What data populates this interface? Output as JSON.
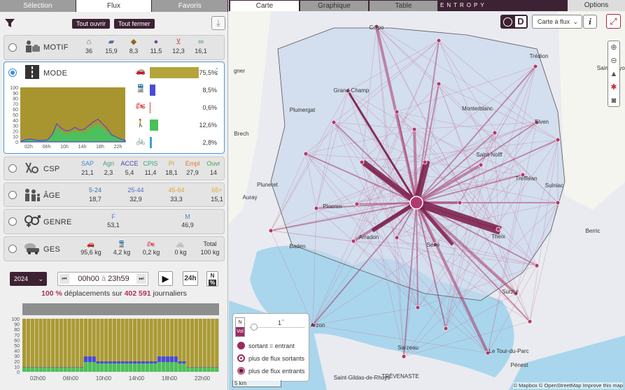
{
  "left_tabs": [
    "Sélection",
    "Flux",
    "Favoris"
  ],
  "toolbar": {
    "open_all": "Tout ouvrir",
    "close_all": "Tout fermer"
  },
  "motif": {
    "title": "MOTIF",
    "values": [
      "36",
      "15,9",
      "8,3",
      "11,5",
      "12,3",
      "16,1"
    ],
    "icons": [
      "home-icon",
      "briefcase-icon",
      "graduation-cap-icon",
      "ball-icon",
      "shopping-cart-icon",
      "glasses-icon"
    ],
    "colors": [
      "#4a7a3a",
      "#4b6ea7",
      "#8a6a1e",
      "#7a4aa0",
      "#c45a66",
      "#3d8a8a"
    ]
  },
  "mode": {
    "title": "MODE",
    "items": [
      {
        "icon": "car-icon",
        "label": "75,5%",
        "value": 75.5,
        "color": "#b5a43a"
      },
      {
        "icon": "train-icon",
        "label": "8,5%",
        "value": 8.5,
        "color": "#4a4ad8"
      },
      {
        "icon": "motorbike-icon",
        "label": "0,6%",
        "value": 0.6,
        "color": "#d44a4a"
      },
      {
        "icon": "walking-icon",
        "label": "12,6%",
        "value": 12.6,
        "color": "#4ac05a"
      },
      {
        "icon": "bicycle-icon",
        "label": "2,8%",
        "value": 2.8,
        "color": "#3aa0d0"
      }
    ],
    "chart_y": [
      "100",
      "90",
      "80",
      "70",
      "60",
      "50",
      "40",
      "30",
      "20",
      "10",
      "0"
    ],
    "chart_x": [
      "02h",
      "06h",
      "10h",
      "14h",
      "18h",
      "22h"
    ]
  },
  "csp": {
    "title": "CSP",
    "labels": [
      "SAP",
      "Agri",
      "ACCE",
      "CPIS",
      "PI",
      "Empl",
      "Ouvr"
    ],
    "values": [
      "21,1",
      "2,3",
      "5,4",
      "11,4",
      "18,1",
      "27,9",
      "14"
    ],
    "colors": [
      "#4a8ad8",
      "#4aa07a",
      "#3b4ab0",
      "#3aa07a",
      "#d8a030",
      "#e07a30",
      "#4aa050"
    ]
  },
  "age": {
    "title": "ÂGE",
    "labels": [
      "5-24",
      "25-44",
      "45-64",
      "65+"
    ],
    "values": [
      "18,7",
      "32,9",
      "33,3",
      "15,1"
    ],
    "colors": [
      "#3a70b0",
      "#4a70c8",
      "#e0a030",
      "#e8a830"
    ]
  },
  "genre": {
    "title": "GENRE",
    "labels": [
      "F",
      "M"
    ],
    "values": [
      "53,1",
      "46,9"
    ]
  },
  "ges": {
    "title": "GES",
    "values": [
      "95,6 kg",
      "4,2 kg",
      "0,2 kg",
      "0 kg",
      "100 kg"
    ],
    "total": "Total"
  },
  "time": {
    "year": "2024",
    "from": "00h00",
    "sep": "à",
    "to": "23h59",
    "range_btn": "24h",
    "n_btn": "N",
    "pct": "100 %",
    "mid": "déplacements sur",
    "count": "402 591",
    "end": "journaliers"
  },
  "bottom_chart": {
    "y": [
      "100",
      "90",
      "80",
      "70",
      "60",
      "50",
      "40",
      "30",
      "20",
      "10",
      "0"
    ],
    "x": [
      "02h00",
      "06h00",
      "10h00",
      "14h00",
      "18h00",
      "22h00"
    ]
  },
  "map_tabs": [
    "Carte",
    "Graphique",
    "Table"
  ],
  "brand": "ENTROPY",
  "options": "Options",
  "map_ctrl": {
    "d_letter": "D",
    "view_select": "Carte à flux",
    "info": "i"
  },
  "legend": {
    "n": "N",
    "vol": "Vol",
    "count": "1",
    "r1": "sortant = entrant",
    "r2": "plus de flux sortants",
    "r3": "plus de flux entrants",
    "c1": "#9b2b5f",
    "c2": "#c44e7e",
    "c3": "#5a1734"
  },
  "scale": "5 km",
  "attribution": "© Mapbox © OpenStreetMap  Improve this map",
  "places": [
    {
      "n": "Colpo"
    },
    {
      "n": "Trédion"
    },
    {
      "n": "Saint-Guyon"
    },
    {
      "n": "Grand-Champ"
    },
    {
      "n": "Plumergat"
    },
    {
      "n": "Monterblanc"
    },
    {
      "n": "Elven"
    },
    {
      "n": "Brech"
    },
    {
      "n": "Saint-Nolff"
    },
    {
      "n": "Treffléan"
    },
    {
      "n": "Sulniac"
    },
    {
      "n": "Pluneret"
    },
    {
      "n": "Auray"
    },
    {
      "n": "Ploeren"
    },
    {
      "n": "Berric"
    },
    {
      "n": "Baden"
    },
    {
      "n": "Arradon"
    },
    {
      "n": "Séné"
    },
    {
      "n": "Theix"
    },
    {
      "n": "Surzur"
    },
    {
      "n": "Arzon"
    },
    {
      "n": "Sarzeau"
    },
    {
      "n": "Le Tour-du-Parc"
    },
    {
      "n": "Saint-Gildas-de-Rhuys"
    },
    {
      "n": "TRÉVENASTE"
    },
    {
      "n": "Pénest"
    },
    {
      "n": "gner"
    }
  ]
}
